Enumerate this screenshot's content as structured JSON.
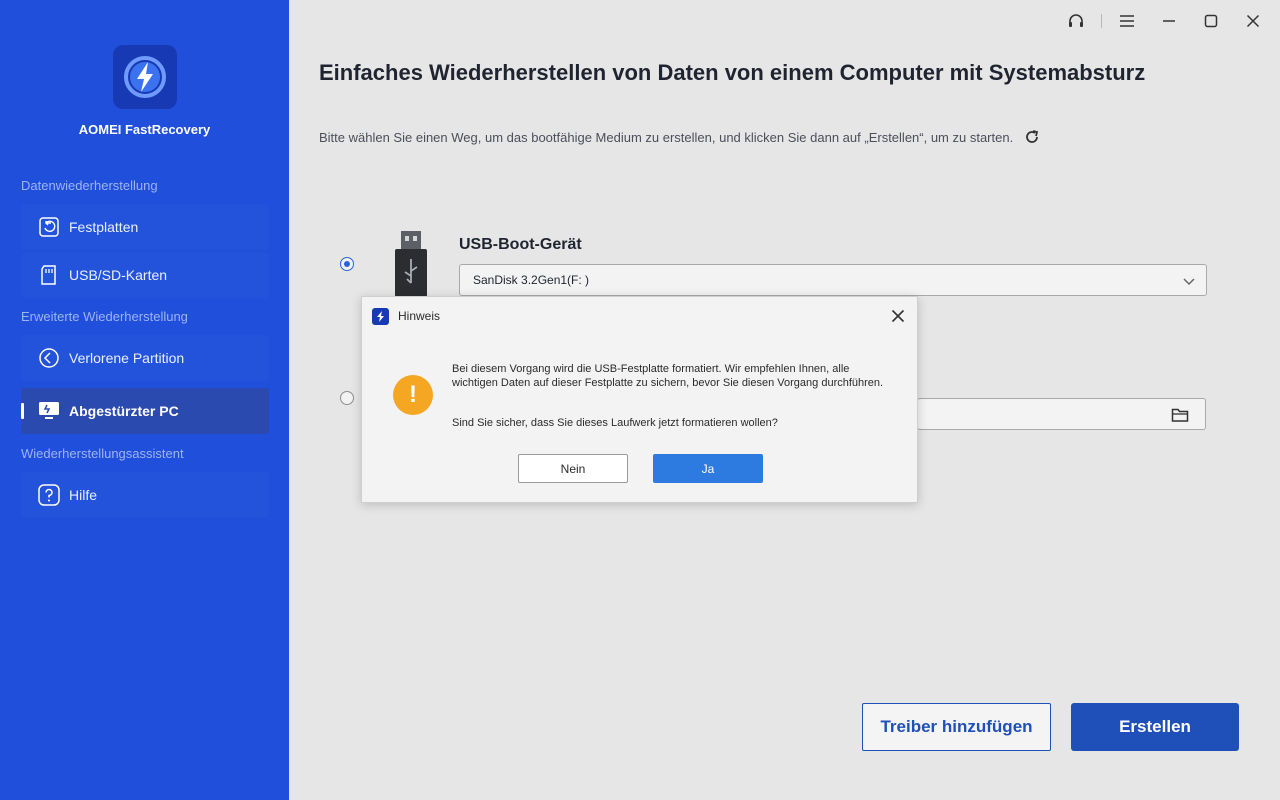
{
  "app": {
    "name": "AOMEI FastRecovery"
  },
  "sidebar": {
    "sections": [
      {
        "label": "Datenwiederherstellung"
      },
      {
        "label": "Erweiterte Wiederherstellung"
      },
      {
        "label": "Wiederherstellungsassistent"
      }
    ],
    "items": [
      {
        "label": "Festplatten",
        "icon": "restore-disk-icon",
        "active": false
      },
      {
        "label": "USB/SD-Karten",
        "icon": "sd-card-icon",
        "active": false
      },
      {
        "label": "Verlorene Partition",
        "icon": "partition-icon",
        "active": false
      },
      {
        "label": "Abgestürzter PC",
        "icon": "monitor-icon",
        "active": true
      },
      {
        "label": "Hilfe",
        "icon": "help-icon",
        "active": false
      }
    ]
  },
  "main": {
    "title": "Einfaches Wiederherstellen von Daten von einem Computer mit Systemabsturz",
    "subtitle": "Bitte wählen Sie einen Weg, um das bootfähige Medium zu erstellen, und klicken Sie dann auf „Erstellen“, um zu starten.",
    "usb_option": {
      "label": "USB-Boot-Gerät",
      "selected_device": "SanDisk 3.2Gen1(F: )",
      "checked": true
    },
    "iso_option": {
      "checked": false
    },
    "buttons": {
      "add_driver": "Treiber hinzufügen",
      "create": "Erstellen"
    }
  },
  "dialog": {
    "title": "Hinweis",
    "message": "Bei diesem Vorgang wird die USB-Festplatte formatiert. Wir empfehlen Ihnen, alle wichtigen Daten auf dieser Festplatte zu sichern, bevor Sie diesen Vorgang durchführen.",
    "question": "Sind Sie sicher, dass Sie dieses Laufwerk jetzt formatieren wollen?",
    "no_label": "Nein",
    "yes_label": "Ja",
    "warn_glyph": "!"
  },
  "colors": {
    "sidebar_bg": "#1f4fdb",
    "accent": "#1f4fb8",
    "warning": "#f5a623",
    "dialog_primary": "#2d7ae0"
  }
}
